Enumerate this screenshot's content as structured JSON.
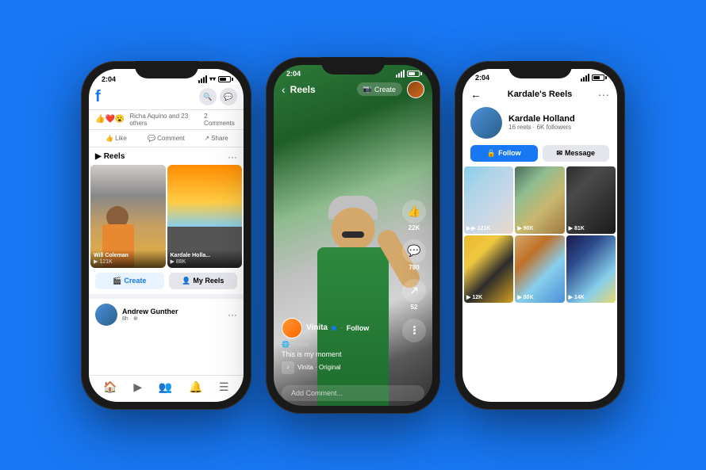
{
  "background_color": "#1877F2",
  "phones": {
    "left": {
      "status_time": "2:04",
      "status_wifi": "wifi",
      "status_battery": "battery",
      "reaction_text": "Richa Aquino and 23 others",
      "comments_count": "2 Comments",
      "btn_like": "Like",
      "btn_comment": "Comment",
      "btn_share": "Share",
      "reels_section_title": "Reels",
      "reel1_creator": "Will Coleman",
      "reel1_views": "▶ 121K",
      "reel2_creator": "Kardale Holla...",
      "reel2_views": "▶ 88K",
      "btn_create": "Create",
      "btn_my_reels": "My Reels",
      "post_author": "Andrew Gunther",
      "post_time": "8h · ⊕",
      "nav_items": [
        "🏠",
        "▶",
        "👥",
        "🔔",
        "☰"
      ]
    },
    "center": {
      "status_time": "2:04",
      "header_title": "Reels",
      "btn_create": "Create",
      "username": "Vinita",
      "verified": true,
      "follow_label": "Follow",
      "visibility": "Public",
      "caption": "This is my moment",
      "audio_label": "Vinita · Original",
      "likes_count": "22K",
      "comments_count": "780",
      "shares_count": "52",
      "comment_placeholder": "Add Comment...",
      "more_icon": "···"
    },
    "right": {
      "status_time": "2:04",
      "page_title": "Kardale's Reels",
      "profile_name": "Kardale Holland",
      "profile_stats": "16 reels · 6K followers",
      "btn_follow": "Follow",
      "btn_message": "Message",
      "reels": [
        {
          "views": "▶ 121K",
          "bg": "pr1"
        },
        {
          "views": "▶ 90K",
          "bg": "pr2"
        },
        {
          "views": "▶ 81K",
          "bg": "pr3"
        },
        {
          "views": "▶ 12K",
          "bg": "pr4"
        },
        {
          "views": "▶ 80K",
          "bg": "pr5"
        },
        {
          "views": "▶ 14K",
          "bg": "pr6"
        }
      ]
    }
  }
}
